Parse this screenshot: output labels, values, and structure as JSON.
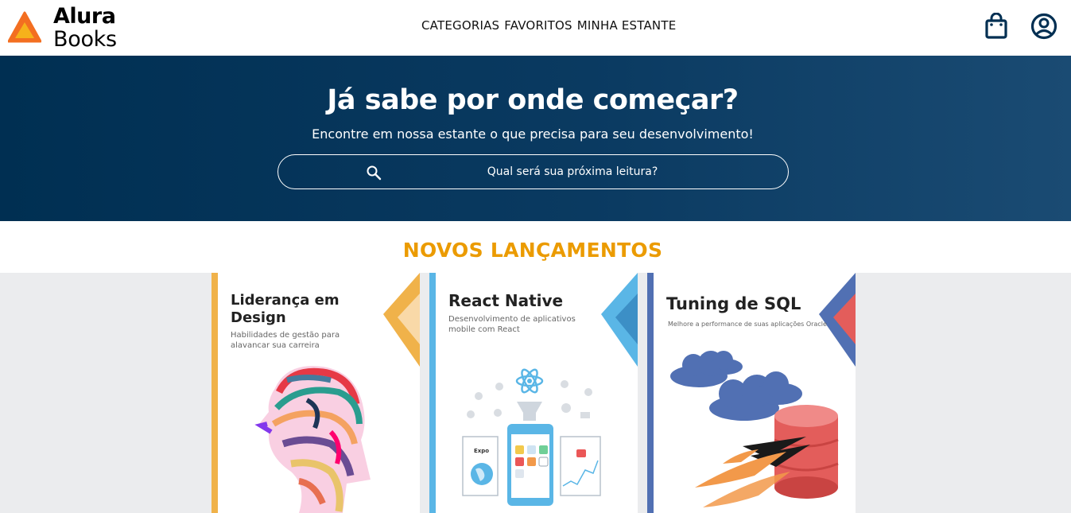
{
  "brand": {
    "line1": "Alura",
    "line2": "Books"
  },
  "nav": {
    "categorias": "CATEGORIAS",
    "favoritos": "FAVORITOS",
    "estante": "MINHA ESTANTE"
  },
  "hero": {
    "title": "Já sabe por onde começar?",
    "subtitle": "Encontre em nossa estante o que precisa para seu desenvolvimento!",
    "search_placeholder": "Qual será sua próxima leitura?"
  },
  "section": {
    "title": "NOVOS LANÇAMENTOS"
  },
  "books": [
    {
      "title_l1": "Liderança em",
      "title_l2": "Design",
      "subtitle_l1": "Habilidades de gestão para",
      "subtitle_l2": "alavancar sua carreira",
      "accent": "#f0b24a"
    },
    {
      "title_l1": "React Native",
      "subtitle_l1": "Desenvolvimento de aplicativos",
      "subtitle_l2": "mobile com React",
      "accent": "#5ab6e6",
      "badge": "Expo"
    },
    {
      "title_l1": "Tuning de SQL",
      "subtitle_l1": "Melhore a performance de suas aplicações Oracle",
      "accent": "#5170b3"
    }
  ],
  "colors": {
    "hero_bg": "#002f52",
    "accent_orange": "#eb9b00",
    "shelf_bg": "#ebecee"
  },
  "icons": {
    "logo": "alura-triangle-logo",
    "bag": "shopping-bag-icon",
    "user": "user-profile-icon",
    "search": "search-icon"
  }
}
